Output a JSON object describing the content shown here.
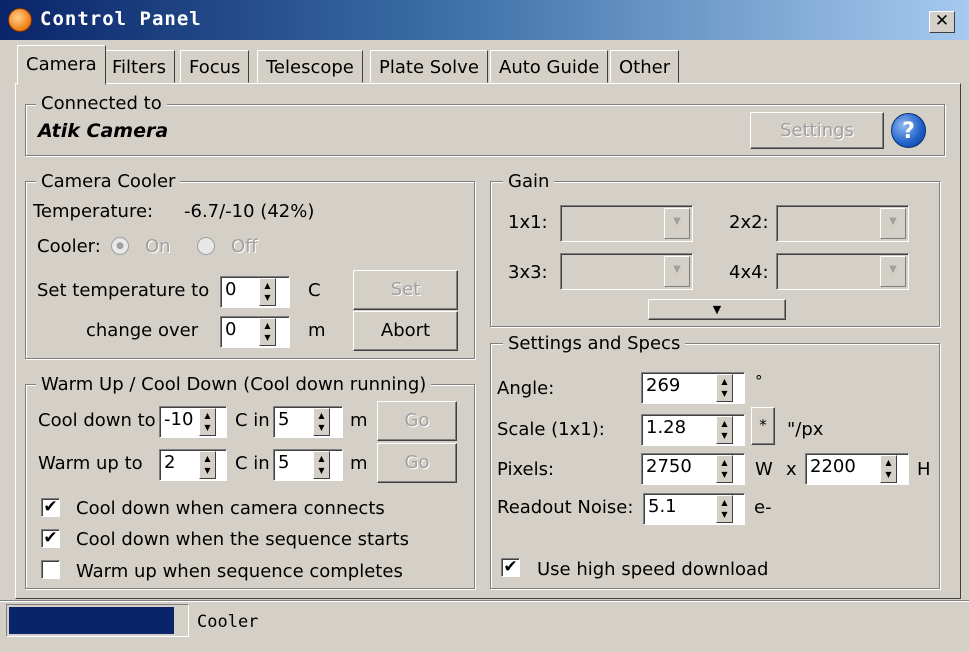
{
  "window": {
    "title": "Control Panel",
    "close_glyph": "✕"
  },
  "tabs": [
    "Camera",
    "Filters",
    "Focus",
    "Telescope",
    "Plate Solve",
    "Auto Guide",
    "Other"
  ],
  "connected": {
    "legend": "Connected to",
    "camera_name": "Atik Camera",
    "settings_label": "Settings",
    "help_glyph": "?"
  },
  "cooler": {
    "legend": "Camera Cooler",
    "temperature_label": "Temperature:",
    "temperature_value": "-6.7/-10 (42%)",
    "cooler_label": "Cooler:",
    "on_label": "On",
    "off_label": "Off",
    "set_temp_label": "Set temperature to",
    "set_temp_value": "0",
    "set_temp_unit": "C",
    "set_label": "Set",
    "change_over_label": "change over",
    "change_over_value": "0",
    "change_over_unit": "m",
    "abort_label": "Abort"
  },
  "warm": {
    "legend": "Warm Up / Cool Down (Cool down running)",
    "cool_label": "Cool down to",
    "cool_temp": "-10",
    "cin_label": "C in",
    "cool_min": "5",
    "m_label": "m",
    "go_label": "Go",
    "warm_label": "Warm up to",
    "warm_temp": "2",
    "warm_min": "5",
    "checks": [
      {
        "label": "Cool down when camera connects",
        "checked": true
      },
      {
        "label": "Cool down when the sequence starts",
        "checked": true
      },
      {
        "label": "Warm up when sequence completes",
        "checked": false
      }
    ]
  },
  "gain": {
    "legend": "Gain",
    "labels": [
      "1x1:",
      "2x2:",
      "3x3:",
      "4x4:"
    ],
    "expand_glyph": "▼"
  },
  "specs": {
    "legend": "Settings and Specs",
    "angle_label": "Angle:",
    "angle_value": "269",
    "angle_unit": "°",
    "scale_label": "Scale (1x1):",
    "scale_value": "1.28",
    "scale_btn": "*",
    "scale_unit": "\"/px",
    "pixels_label": "Pixels:",
    "pixels_w": "2750",
    "w_label": "W",
    "x_label": "x",
    "pixels_h": "2200",
    "h_label": "H",
    "noise_label": "Readout Noise:",
    "noise_value": "5.1",
    "noise_unit": "e-",
    "high_speed_label": "Use high speed download",
    "high_speed_checked": true
  },
  "status": {
    "text": "Cooler",
    "progress": 1.0,
    "progress_color": "#0a246a"
  },
  "check_glyph": "✔"
}
